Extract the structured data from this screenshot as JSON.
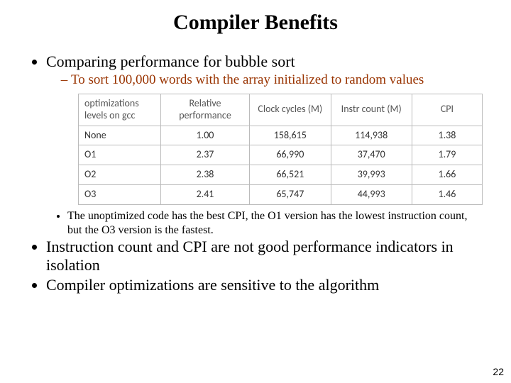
{
  "title": "Compiler Benefits",
  "bullet1": "Comparing performance for bubble sort",
  "sub1": "To sort 100,000 words with the array initialized to random values",
  "chart_data": {
    "type": "table",
    "headers": [
      "optimizations levels on gcc",
      "Relative performance",
      "Clock cycles (M)",
      "Instr count (M)",
      "CPI"
    ],
    "rows": [
      [
        "None",
        "1.00",
        "158,615",
        "114,938",
        "1.38"
      ],
      [
        "O1",
        "2.37",
        "66,990",
        "37,470",
        "1.79"
      ],
      [
        "O2",
        "2.38",
        "66,521",
        "39,993",
        "1.66"
      ],
      [
        "O3",
        "2.41",
        "65,747",
        "44,993",
        "1.46"
      ]
    ]
  },
  "note1": "The unoptimized code has the best CPI, the O1 version has the lowest instruction count, but the O3 version is the fastest.",
  "bullet2": "Instruction count and CPI are not good performance indicators in isolation",
  "bullet3": "Compiler optimizations are sensitive to the algorithm",
  "page": "22"
}
